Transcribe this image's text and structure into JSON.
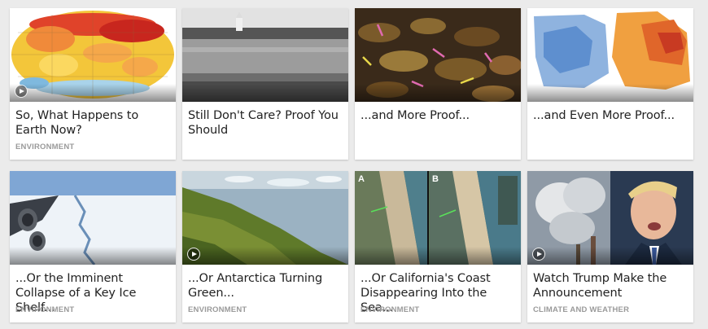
{
  "cards": [
    {
      "title": "So, What Happens to Earth Now?",
      "category": "ENVIRONMENT",
      "has_play": true,
      "thumb": "global-temperature-map"
    },
    {
      "title": "Still Don't Care? Proof You Should",
      "category": "",
      "has_play": false,
      "thumb": "flooded-coastline-photo"
    },
    {
      "title": "...and More Proof...",
      "category": "",
      "has_play": false,
      "thumb": "lobsters-photo"
    },
    {
      "title": "...and Even More Proof...",
      "category": "",
      "has_play": false,
      "thumb": "temperature-change-maps"
    },
    {
      "title": "...Or the Imminent Collapse of a Key Ice Shelf...",
      "category": "ENVIRONMENT",
      "has_play": false,
      "thumb": "ice-shelf-crack-photo"
    },
    {
      "title": "...Or Antarctica Turning Green...",
      "category": "ENVIRONMENT",
      "has_play": true,
      "thumb": "green-antarctica-photo"
    },
    {
      "title": "...Or California's Coast Disappearing Into the Sea...",
      "category": "ENVIRONMENT",
      "has_play": false,
      "thumb": "coastline-before-after"
    },
    {
      "title": "Watch Trump Make the Announcement",
      "category": "CLIMATE AND WEATHER",
      "has_play": true,
      "thumb": "smokestacks-and-trump"
    }
  ],
  "thumb_labels": {
    "coast_a": "A",
    "coast_b": "B"
  }
}
